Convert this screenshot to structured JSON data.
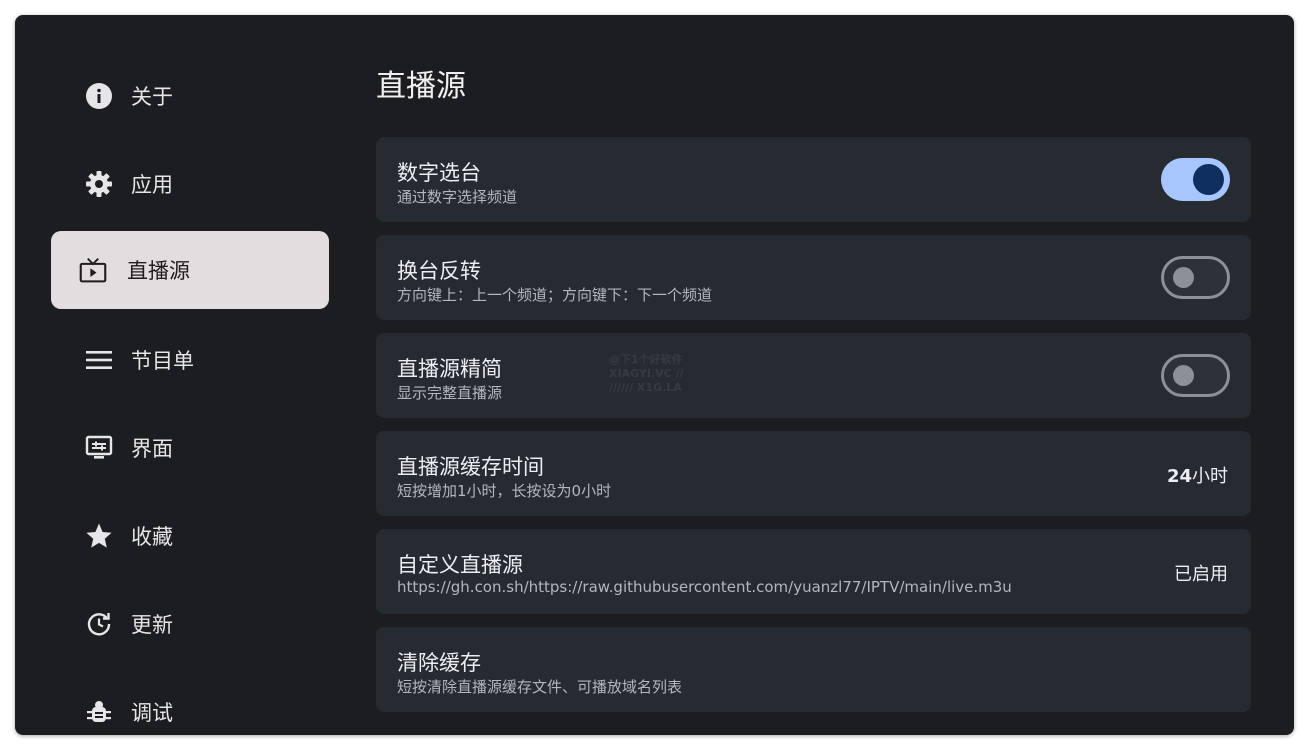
{
  "sidebar": {
    "items": [
      {
        "label": "关于",
        "icon": "info-icon"
      },
      {
        "label": "应用",
        "icon": "gear-icon"
      },
      {
        "label": "直播源",
        "icon": "tv-icon",
        "active": true
      },
      {
        "label": "节目单",
        "icon": "menu-icon"
      },
      {
        "label": "界面",
        "icon": "display-settings-icon"
      },
      {
        "label": "收藏",
        "icon": "star-icon"
      },
      {
        "label": "更新",
        "icon": "update-icon"
      },
      {
        "label": "调试",
        "icon": "bug-icon"
      }
    ]
  },
  "main": {
    "title": "直播源",
    "settings": [
      {
        "title": "数字选台",
        "subtitle": "通过数字选择频道",
        "toggle": true
      },
      {
        "title": "换台反转",
        "subtitle": "方向键上：上一个频道；方向键下：下一个频道",
        "toggle": false
      },
      {
        "title": "直播源精简",
        "subtitle": "显示完整直播源",
        "toggle": false
      },
      {
        "title": "直播源缓存时间",
        "subtitle": "短按增加1小时，长按设为0小时",
        "value_num": "24",
        "value_unit": "小时"
      },
      {
        "title": "自定义直播源",
        "subtitle": "https://gh.con.sh/https://raw.githubusercontent.com/yuanzl77/IPTV/main/live.m3u",
        "value": "已启用"
      },
      {
        "title": "清除缓存",
        "subtitle": "短按清除直播源缓存文件、可播放域名列表"
      }
    ]
  },
  "watermark": {
    "line1": "@下1个好软件",
    "line2": "XIAGYI.VC //",
    "line3": "////// X1G.LA"
  },
  "colors": {
    "accent": "#a7c6ff",
    "knob_on": "#0f2f61",
    "card": "#262a31",
    "background": "#1c1d20",
    "active_nav": "#e3dde0"
  }
}
